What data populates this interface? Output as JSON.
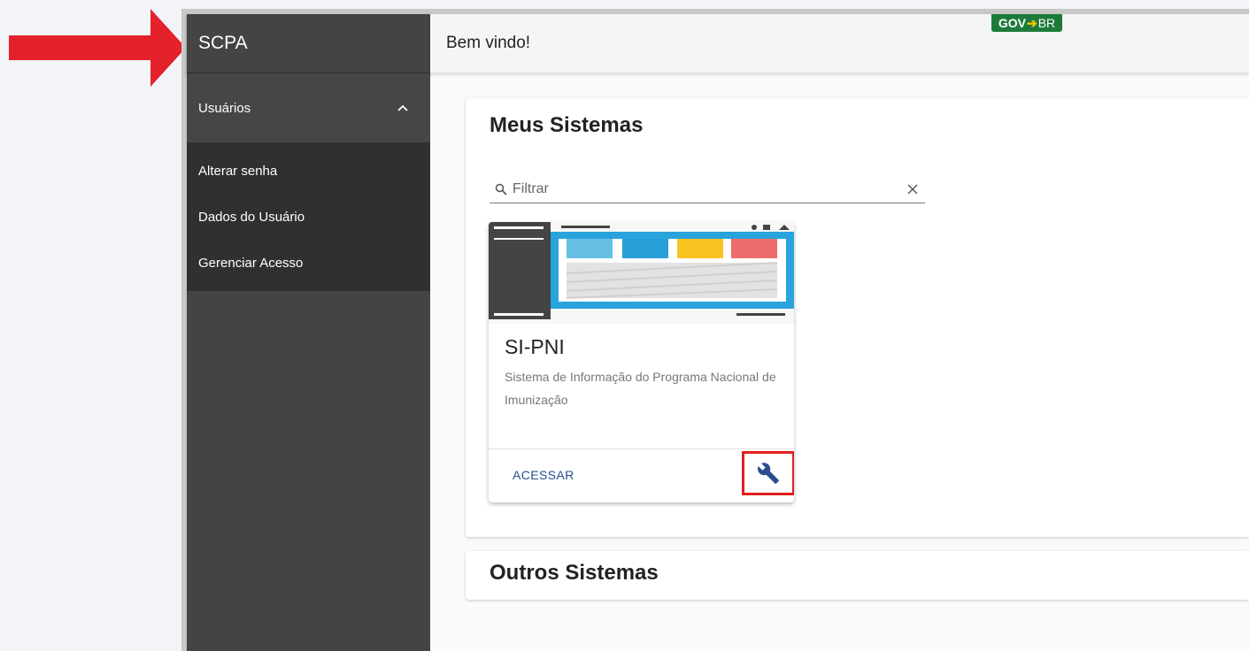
{
  "app": {
    "name": "SCPA",
    "welcome": "Bem vindo!"
  },
  "gov_logo": {
    "gov": "GOV",
    "br": "BR"
  },
  "sidebar": {
    "group_label": "Usuários",
    "items": [
      {
        "label": "Alterar senha"
      },
      {
        "label": "Dados do Usuário"
      },
      {
        "label": "Gerenciar Acesso"
      }
    ]
  },
  "meus_sistemas": {
    "title": "Meus Sistemas",
    "filter_placeholder": "Filtrar",
    "card": {
      "title": "SI-PNI",
      "description": "Sistema de Informação do Programa Nacional de Imunização",
      "action_label": "ACESSAR"
    }
  },
  "outros_sistemas": {
    "title": "Outros Sistemas"
  },
  "colors": {
    "sidebar_bg": "#444444",
    "sidebar_sub_bg": "#303030",
    "accent_blue": "#2a4d8f",
    "annotation_red": "#e02020",
    "gov_green": "#1e7a3a"
  },
  "icons": {
    "group_toggle": "chevron-up-icon",
    "filter_search": "search-icon",
    "filter_clear": "close-icon",
    "settings": "wrench-icon"
  }
}
